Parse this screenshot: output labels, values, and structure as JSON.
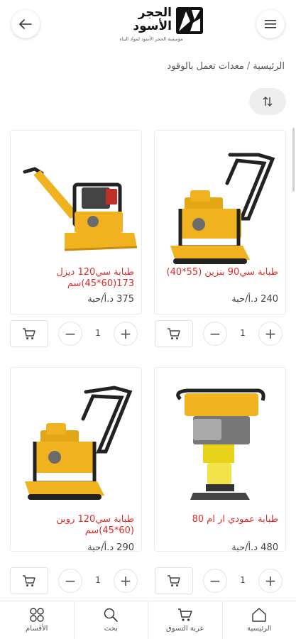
{
  "header": {
    "logo_line1": "الحجر",
    "logo_line2": "الأسود",
    "logo_subtitle": "مؤسسة الحجر الأسود لمواد البناء",
    "menu_icon": "hamburger-icon",
    "back_icon": "arrow-left-icon"
  },
  "breadcrumb": {
    "home": "الرئيسية",
    "separator": "/",
    "current": "معدات تعمل بالوقود"
  },
  "sort_icon": "sort-icon",
  "colors": {
    "title_red": "#e02a2a",
    "machine_yellow": "#f0b21e"
  },
  "products": [
    {
      "title": "طبابة سي90 بنزين (55*40)",
      "price": "240 د.أ/حبة",
      "qty": "1",
      "image": "plate-compactor"
    },
    {
      "title": "طبابة سي120 ديزل 173(60*45)سم",
      "price": "375 د.أ/حبة",
      "qty": "1",
      "image": "reversible-compactor"
    },
    {
      "title": "طبابة عمودي ار ام 80",
      "price": "480 د.أ/حبة",
      "qty": "1",
      "image": "tamping-rammer"
    },
    {
      "title": "طبابة سي120 روبن (60*45)سم",
      "price": "290 د.أ/حبة",
      "qty": "1",
      "image": "plate-compactor"
    }
  ],
  "qty_controls": {
    "plus": "+",
    "minus": "−"
  },
  "bottom_nav": [
    {
      "label": "الرئيسية",
      "icon": "home-icon"
    },
    {
      "label": "عربة التسوق",
      "icon": "cart-icon"
    },
    {
      "label": "بحث",
      "icon": "search-icon"
    },
    {
      "label": "الأقسام",
      "icon": "categories-icon"
    }
  ]
}
